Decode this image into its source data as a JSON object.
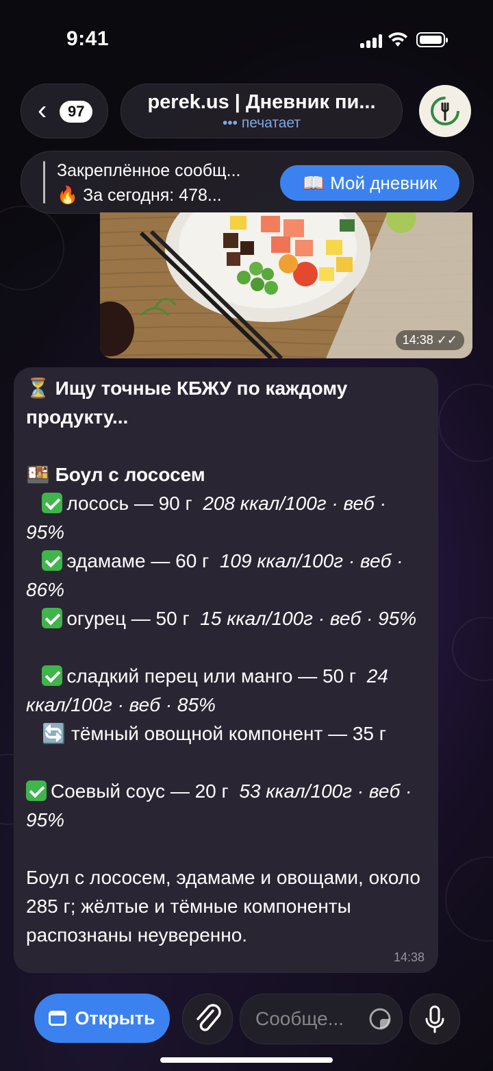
{
  "status_bar": {
    "time": "9:41"
  },
  "header": {
    "back_count": "97",
    "title": "perek.us | Дневник пи...",
    "subtitle": "печатает",
    "typing_dots": "•••"
  },
  "pinned": {
    "line1": "Закреплённое сообщ...",
    "line2": "За сегодня: 478...",
    "button": "Мой дневник"
  },
  "photo": {
    "timestamp": "14:38"
  },
  "message": {
    "searching": "Ищу точные КБЖУ по каждому продукту...",
    "dish": "Боул с лососем",
    "items": [
      {
        "name": "лосось — 90 г",
        "meta": "208 ккал/100г · веб · 95%",
        "icon": "check-icon"
      },
      {
        "name": "эдамаме — 60 г",
        "meta": "109 ккал/100г · веб · 86%",
        "icon": "check-icon"
      },
      {
        "name": "огурец — 50 г",
        "meta": "15 ккал/100г · веб · 95%",
        "icon": "check-icon"
      },
      {
        "name": "сладкий перец или манго — 50 г",
        "meta": "24 ккал/100г · веб · 85%",
        "icon": "check-icon"
      },
      {
        "name": "тёмный овощной компонент — 35 г",
        "meta": "",
        "icon": "refresh-icon"
      }
    ],
    "sauce": {
      "name": "Соевый соус — 20 г",
      "meta": "53 ккал/100г · веб · 95%"
    },
    "summary": "Боул с лососем, эдамаме и овощами, около 285 г; жёлтые и тёмные компоненты распознаны неуверенно.",
    "timestamp": "14:38"
  },
  "input_bar": {
    "open_button": "Открыть",
    "placeholder": "Сообще..."
  },
  "colors": {
    "accent": "#3b82f0",
    "bubble": "#2a2533",
    "check": "#3fb54b",
    "typing": "#7fa8e6"
  }
}
